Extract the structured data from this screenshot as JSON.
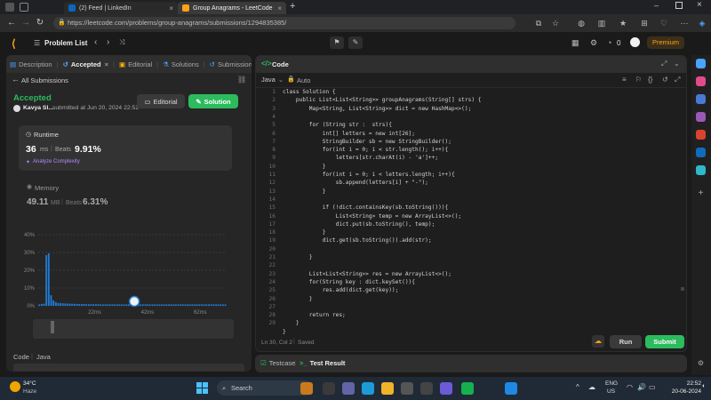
{
  "browser": {
    "tabs": [
      {
        "title": "(2) Feed | LinkedIn",
        "favicon_color": "#0a66c2"
      },
      {
        "title": "Group Anagrams - LeetCode",
        "favicon_color": "#ffa116"
      }
    ],
    "url": "https://leetcode.com/problems/group-anagrams/submissions/1294835385/"
  },
  "nav": {
    "problem_list": "Problem List",
    "notifications_count": "0",
    "premium": "Premium"
  },
  "left": {
    "tabs": [
      "Description",
      "Accepted",
      "Editorial",
      "Solutions",
      "Submissions"
    ],
    "all_submissions": "All Submissions",
    "status": "Accepted",
    "user": "Kavya Sl...",
    "submitted": "submitted at Jun 20, 2024 22:52",
    "editorial_btn": "Editorial",
    "solution_btn": "Solution",
    "runtime_label": "Runtime",
    "runtime_value": "36",
    "runtime_unit": "ms",
    "beats_label": "Beats",
    "runtime_beats": "9.91%",
    "analyze": "Analyze Complexity",
    "memory_label": "Memory",
    "memory_value": "49.11",
    "memory_unit": "MB",
    "memory_beats": "6.31%",
    "code_label": "Code",
    "code_lang": "Java"
  },
  "chart_data": {
    "type": "bar",
    "y_ticks": [
      "40%",
      "30%",
      "20%",
      "10%",
      "0%"
    ],
    "x_ticks": [
      "22ms",
      "42ms",
      "62ms"
    ],
    "ylim": [
      0,
      40
    ],
    "values": [
      0.8,
      1.0,
      1.2,
      28.5,
      29.5,
      6,
      3,
      2,
      1.6,
      1.5,
      1.4,
      1.3,
      1.2,
      1.2,
      1.1,
      1.1,
      1.0,
      1.0,
      1.0,
      1.0,
      0.9,
      0.9,
      0.9,
      0.9,
      0.9,
      0.9,
      0.8,
      0.8,
      0.8,
      0.8,
      0.8,
      0.8,
      0.8,
      0.8,
      0.8,
      0.8,
      0.8,
      0.8,
      0.8,
      0.8,
      0.8,
      0.8,
      0.8,
      0.8,
      0.8,
      0.8,
      0.8,
      0.8,
      0.8,
      0.8,
      0.8,
      0.8,
      0.8,
      0.8,
      0.8,
      0.8,
      0.8,
      0.8,
      0.8,
      0.8,
      0.8,
      0.8,
      0.8,
      0.8,
      0.8,
      0.8,
      0.8,
      0.8,
      0.8,
      0.8,
      0.8,
      0.8,
      0.8,
      0.8,
      0.8,
      0.8,
      0.8,
      0.8,
      0.8,
      0.8
    ],
    "bar_color": "#1f7ad6"
  },
  "right": {
    "code_tab": "Code",
    "language": "Java",
    "auto": "Auto",
    "code_lines": [
      "class Solution {",
      "    public List<List<String>> groupAnagrams(String[] strs) {",
      "        Map<String, List<String>> dict = new HashMap<>();",
      "",
      "        for (String str :  strs){",
      "            int[] letters = new int[26];",
      "            StringBuilder sb = new StringBuilder();",
      "            for(int i = 0; i < str.length(); i++){",
      "                letters[str.charAt(i) - 'a']++;",
      "            }",
      "            for(int i = 0; i < letters.length; i++){",
      "                sb.append(letters[i] + \"-\");",
      "            }",
      "",
      "            if (!dict.containsKey(sb.toString())){",
      "                List<String> temp = new ArrayList<>();",
      "                dict.put(sb.toString(), temp);",
      "            }",
      "            dict.get(sb.toString()).add(str);",
      "",
      "        }",
      "",
      "        List<List<String>> res = new ArrayList<>();",
      "        for(String key : dict.keySet()){",
      "            res.add(dict.get(key));",
      "        }",
      "",
      "        return res;",
      "    }",
      "}"
    ],
    "line_numbers": [
      "1",
      "2",
      "3",
      "4",
      "5",
      "6",
      "7",
      "8",
      "9",
      "10",
      "11",
      "12",
      "13",
      "14",
      "15",
      "16",
      "17",
      "18",
      "19",
      "20",
      "21",
      "22",
      "23",
      "24",
      "25",
      "26",
      "27",
      "28",
      "29"
    ],
    "cursor_pos": "Ln 30, Col 2",
    "saved": "Saved",
    "run": "Run",
    "submit": "Submit",
    "testcase": "Testcase",
    "test_result": "Test Result"
  },
  "taskbar": {
    "temp": "34°C",
    "weather": "Haze",
    "search": "Search",
    "lang1": "ENG",
    "lang2": "US",
    "time": "22:52",
    "date": "20-06-2024"
  }
}
